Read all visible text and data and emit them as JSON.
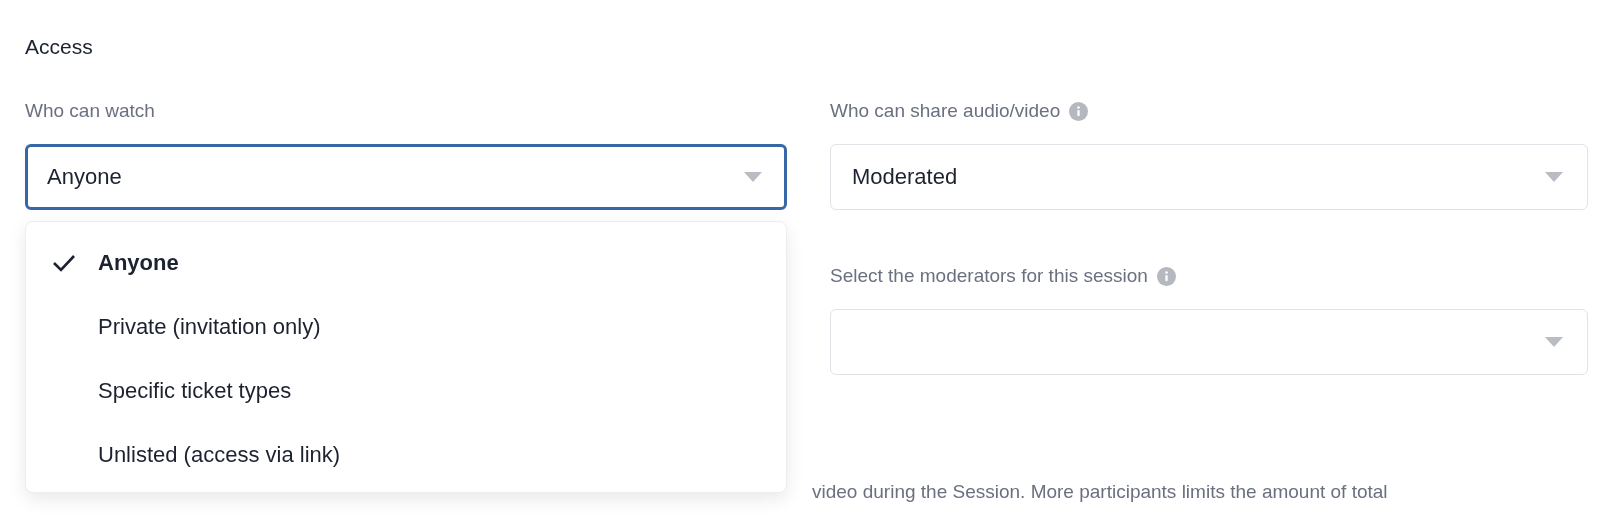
{
  "section": {
    "title": "Access"
  },
  "fields": [
    {
      "label": "Who can watch",
      "value": "Anyone",
      "focused": true,
      "options": [
        {
          "label": "Anyone",
          "selected": true
        },
        {
          "label": "Private (invitation only)",
          "selected": false
        },
        {
          "label": "Specific ticket types",
          "selected": false
        },
        {
          "label": "Unlisted (access via link)",
          "selected": false
        }
      ]
    },
    {
      "label": "Who can share audio/video",
      "info": true,
      "value": "Moderated",
      "focused": false
    },
    {
      "label": "Select the moderators for this session",
      "info": true,
      "focused": false
    }
  ],
  "description": {
    "text": "video during the Session. More participants limits the amount of total"
  }
}
